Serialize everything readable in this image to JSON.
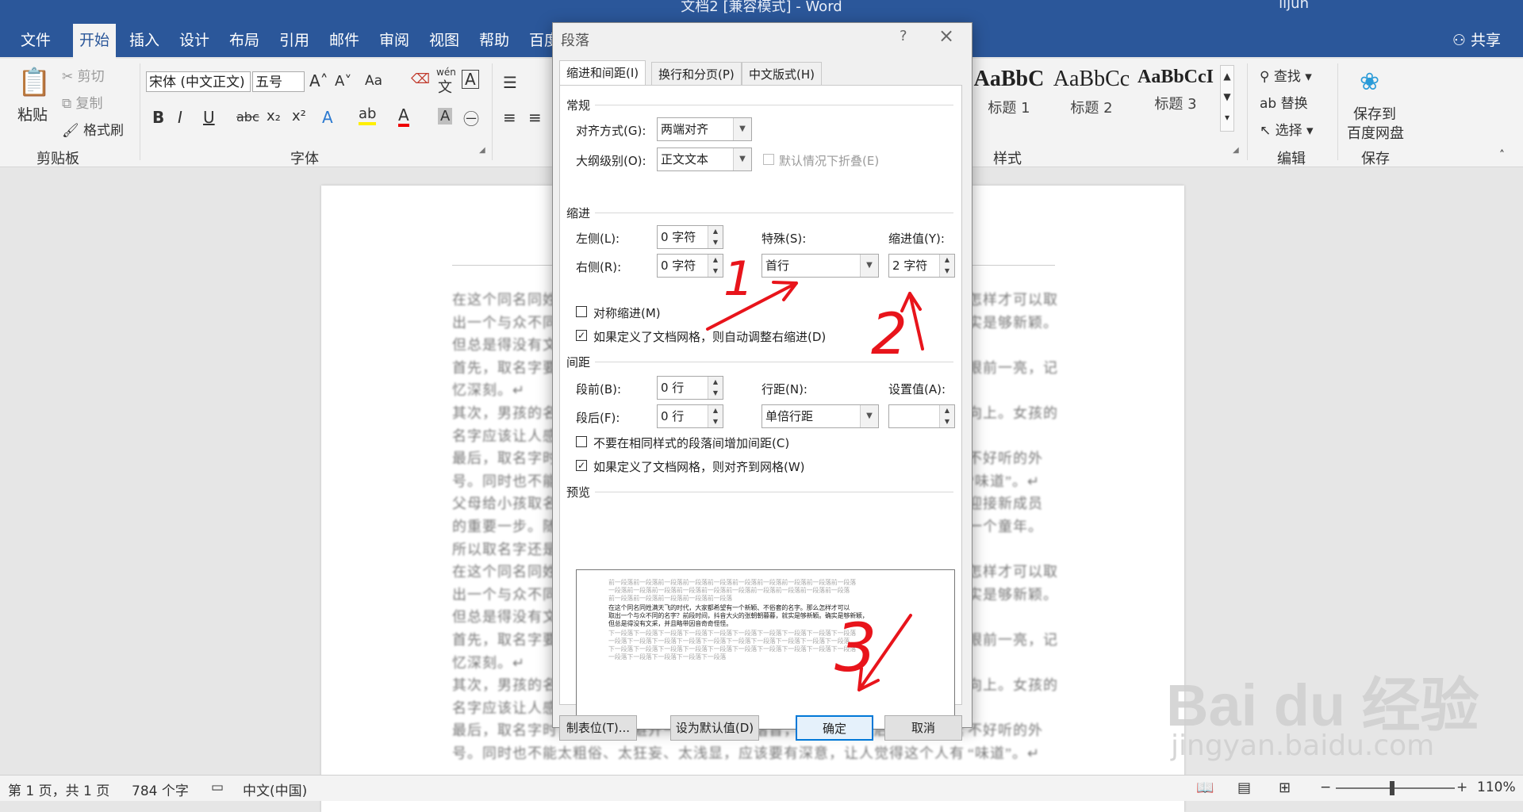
{
  "window": {
    "title": "文档2 [兼容模式] - Word",
    "user": "lijun"
  },
  "ribbon_tabs": [
    "文件",
    "开始",
    "插入",
    "设计",
    "布局",
    "引用",
    "邮件",
    "审阅",
    "视图",
    "帮助",
    "百度"
  ],
  "active_tab": "开始",
  "share_label": "共享",
  "clipboard": {
    "paste": "粘贴",
    "cut": "剪切",
    "copy": "复制",
    "format_painter": "格式刷",
    "group": "剪贴板"
  },
  "font": {
    "name": "宋体 (中文正文)",
    "size": "五号",
    "group": "字体",
    "case_label": "Aa",
    "wen_label": "wén",
    "wen_char": "文",
    "bold": "B",
    "italic": "I",
    "underline": "U",
    "strike": "abc",
    "sub": "x₂",
    "sup": "x²"
  },
  "styles": {
    "group": "样式",
    "items": [
      {
        "preview": "AaBbC",
        "name": "标题 1"
      },
      {
        "preview": "AaBbCc",
        "name": "标题 2"
      },
      {
        "preview": "AaBbCcI",
        "name": "标题 3"
      }
    ]
  },
  "editing": {
    "find": "查找",
    "replace": "替换",
    "select": "选择",
    "group": "编辑"
  },
  "save_group": {
    "label1": "保存到",
    "label2": "百度网盘",
    "group": "保存"
  },
  "document": {
    "left_lines": [
      "在这个同名同姓",
      "出一个与众不同",
      "但总是得没有文",
      "首先，取名字要",
      "忆深刻。↵",
      "其次，男孩的名",
      "名字应该让人感",
      "最后，取名字时",
      "号。同时也不能",
      "父母给小孩取名",
      "的重要一步。随",
      "所以取名字还是",
      "在这个同名同姓",
      "出一个与众不同",
      "但总是得没有文",
      "首先，取名字要",
      "忆深刻。↵",
      "其次，男孩的名",
      "名字应该让人感",
      "最后，取名字时，应该尽量避开一些不好听的谐音，这样孩子以后才容易被延",
      "号。同时也不能太粗俗、太狂妄、太浅显，应该要有深意，让人觉得这个人有"
    ],
    "right_lines": [
      "怎样才可以取",
      "实是够新颖。",
      "",
      "眼前一亮，记",
      "",
      "向上。女孩的",
      "",
      "不好听的外",
      "“味道”。↵",
      "迎接新成员",
      "一个童年。",
      "",
      "怎样才可以取",
      "实是够新颖。",
      "",
      "眼前一亮，记",
      "",
      "向上。女孩的",
      "",
      "不好听的外",
      "“味道”。↵"
    ]
  },
  "dialog": {
    "title": "段落",
    "help": "?",
    "close": "×",
    "tabs": [
      "缩进和间距(I)",
      "换行和分页(P)",
      "中文版式(H)"
    ],
    "general": {
      "section": "常规",
      "alignment_label": "对齐方式(G):",
      "alignment_value": "两端对齐",
      "outline_label": "大纲级别(O):",
      "outline_value": "正文文本",
      "collapse_label": "默认情况下折叠(E)"
    },
    "indent": {
      "section": "缩进",
      "left_label": "左侧(L):",
      "left_value": "0 字符",
      "right_label": "右侧(R):",
      "right_value": "0 字符",
      "special_label": "特殊(S):",
      "special_value": "首行",
      "by_label": "缩进值(Y):",
      "by_value": "2 字符",
      "mirror_label": "对称缩进(M)",
      "mirror_checked": false,
      "auto_adjust_label": "如果定义了文档网格，则自动调整右缩进(D)",
      "auto_adjust_checked": true
    },
    "spacing": {
      "section": "间距",
      "before_label": "段前(B):",
      "before_value": "0 行",
      "after_label": "段后(F):",
      "after_value": "0 行",
      "line_label": "行距(N):",
      "line_value": "单倍行距",
      "at_label": "设置值(A):",
      "at_value": "",
      "no_space_label": "不要在相同样式的段落间增加间距(C)",
      "no_space_checked": false,
      "snap_grid_label": "如果定义了文档网格，则对齐到网格(W)",
      "snap_grid_checked": true
    },
    "preview": {
      "section": "预览",
      "prev_lines": [
        "前一段落前一段落前一段落前一段落前一段落前一段落前一段落前一段落前一段落前一段落",
        "一段落前一段落前一段落前一段落前一段落前一段落前一段落前一段落前一段落前一段落",
        "前一段落前一段落前一段落前一段落前一段落"
      ],
      "body_lines": [
        "    在这个同名同姓满天飞的时代，大家都希望有一个新颖、不俗套的名字。那么怎样才可以",
        "取出一个与众不同的名字？前段时间，抖音大火的张朝朝暮暮，就实是够新颖。确实是够新颖，",
        "但总是得没有文采，并且略带因音奇奇怪怪。"
      ],
      "next_lines": [
        "下一段落下一段落下一段落下一段落下一段落下一段落下一段落下一段落下一段落下一段落",
        "一段落下一段落下一段落下一段落下一段落下一段落下一段落下一段落下一段落下一段落",
        "下一段落下一段落下一段落下一段落下一段落下一段落下一段落下一段落下一段落下一段落",
        "一段落下一段落下一段落下一段落下一段落"
      ]
    },
    "buttons": {
      "tabs": "制表位(T)...",
      "set_default": "设为默认值(D)",
      "ok": "确定",
      "cancel": "取消"
    }
  },
  "annotations": {
    "mark1": "1",
    "mark2": "2",
    "mark3": "3",
    "color": "#e8141b"
  },
  "statusbar": {
    "page": "第 1 页，共 1 页",
    "words": "784 个字",
    "language": "中文(中国)",
    "zoom": "110%"
  },
  "watermark": {
    "logo": "Bai du 经验",
    "url": "jingyan.baidu.com"
  }
}
